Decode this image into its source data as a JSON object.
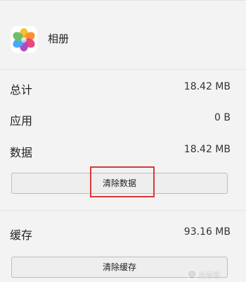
{
  "app": {
    "name": "相册",
    "icon": "photos-flower-icon"
  },
  "storage": {
    "rows": [
      {
        "label": "总计",
        "value": "18.42 MB"
      },
      {
        "label": "应用",
        "value": "0 B"
      },
      {
        "label": "数据",
        "value": "18.42 MB"
      }
    ],
    "clear_data_label": "清除数据"
  },
  "cache": {
    "label": "缓存",
    "value": "93.16 MB",
    "clear_cache_label": "清除缓存"
  },
  "annotation": {
    "highlight_color": "#d83a3a"
  },
  "watermark": {
    "text": "头条号"
  }
}
